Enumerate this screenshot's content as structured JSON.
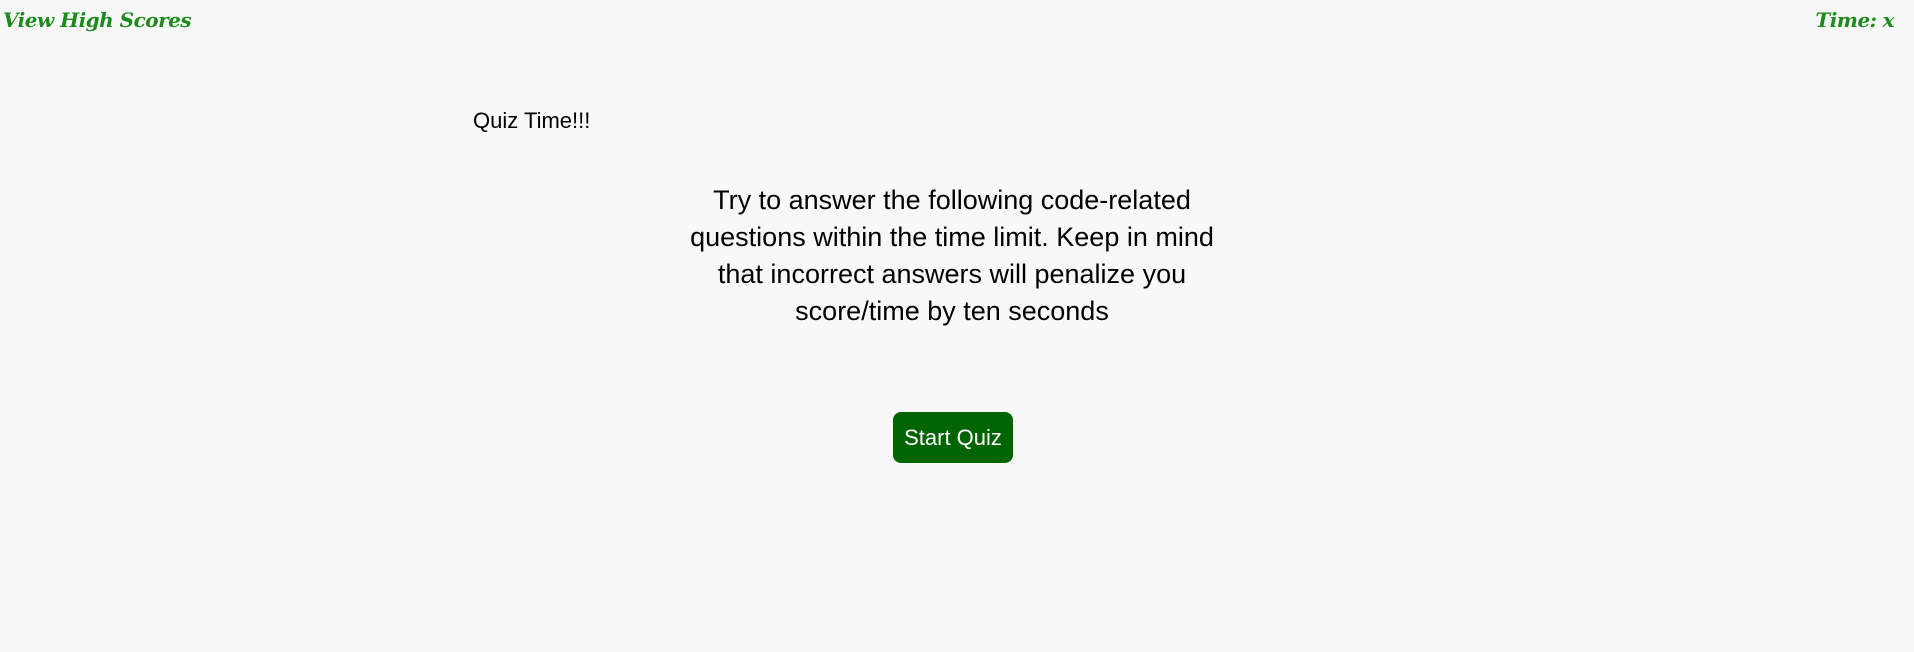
{
  "header": {
    "high_scores_label": "View High Scores",
    "timer_label": "Time:",
    "timer_value": "x"
  },
  "main": {
    "title": "Quiz Time!!!",
    "instructions": "Try to answer the following code-related questions within the time limit. Keep in mind that incorrect answers will penalize you score/time by ten seconds",
    "start_button_label": "Start Quiz"
  },
  "colors": {
    "header_text": "#1e8a1e",
    "button_background": "#006400",
    "button_text": "#ffffff",
    "page_background": "#f8f8f8"
  }
}
